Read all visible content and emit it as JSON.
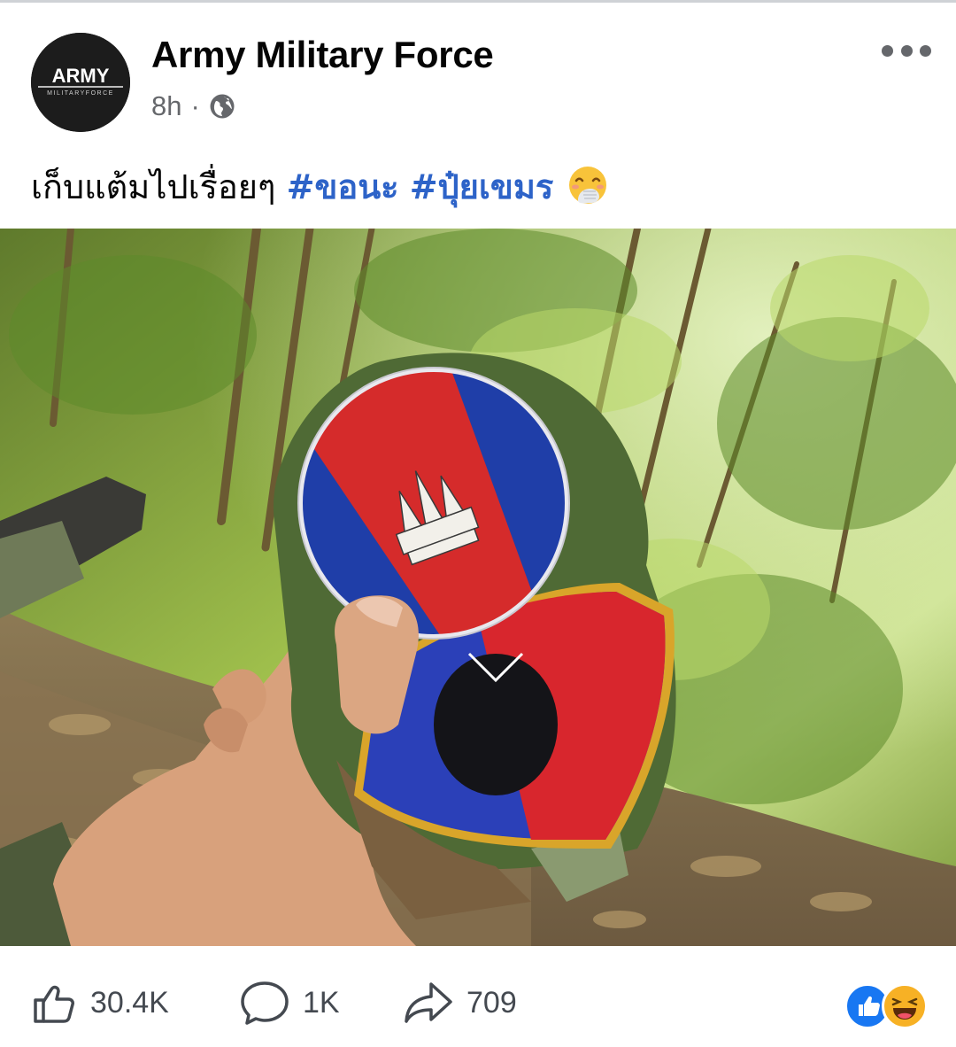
{
  "post": {
    "page_name": "Army Military Force",
    "avatar_text": "ARMY",
    "avatar_subtext": "MILITARYFORCE",
    "time": "8h",
    "separator": "·",
    "privacy_icon": "globe-icon",
    "more_icon": "more-options-icon",
    "caption_text": "เก็บแต้มไปเรื่อยๆ",
    "hashtags": [
      "#ขอนะ",
      "#ปุ๋ยเขมร"
    ],
    "caption_emoji": "face-with-hand-over-mouth-emoji"
  },
  "actions": {
    "like_icon": "thumbs-up-icon",
    "like_count": "30.4K",
    "comment_icon": "comment-bubble-icon",
    "comment_count": "1K",
    "share_icon": "share-arrow-icon",
    "share_count": "709",
    "reactions": [
      "like-reaction-icon",
      "haha-reaction-icon"
    ]
  },
  "colors": {
    "hashtag": "#2d63c8",
    "meta_text": "#65676b",
    "like_blue": "#1877f2",
    "haha_yellow": "#f7b125"
  }
}
